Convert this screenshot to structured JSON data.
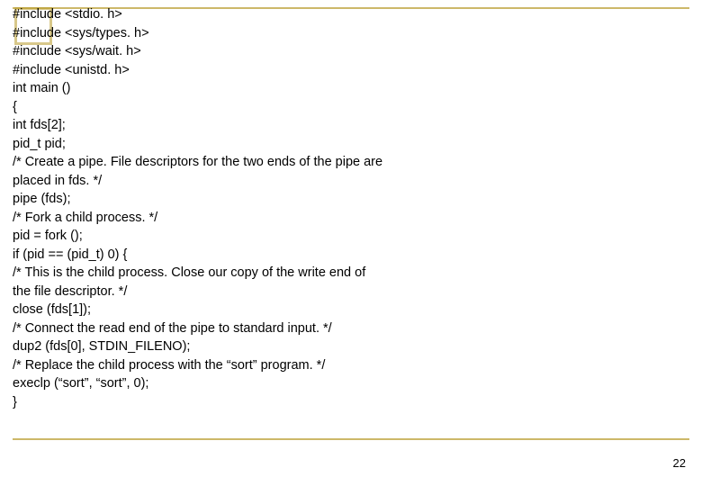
{
  "code": {
    "l1": "#include <stdio. h>",
    "l2": "#include <sys/types. h>",
    "l3": "#include <sys/wait. h>",
    "l4": "#include <unistd. h>",
    "l5": "int main ()",
    "l6": "{",
    "l7": "int fds[2];",
    "l8": "pid_t pid;",
    "l9": "/* Create a pipe. File descriptors for the two ends of the pipe are",
    "l10": "placed in fds. */",
    "l11": "pipe (fds);",
    "l12": "/* Fork a child process. */",
    "l13": "pid = fork ();",
    "l14": "if (pid == (pid_t) 0) {",
    "l15": "/* This is the child process. Close our copy of the write end of",
    "l16": "the file descriptor. */",
    "l17": "close (fds[1]);",
    "l18": "/* Connect the read end of the pipe to standard input. */",
    "l19": "dup2 (fds[0], STDIN_FILENO);",
    "l20": "/* Replace the child process with the “sort” program. */",
    "l21": "execlp (“sort”, “sort”, 0);",
    "l22": "}"
  },
  "page_number": "22"
}
